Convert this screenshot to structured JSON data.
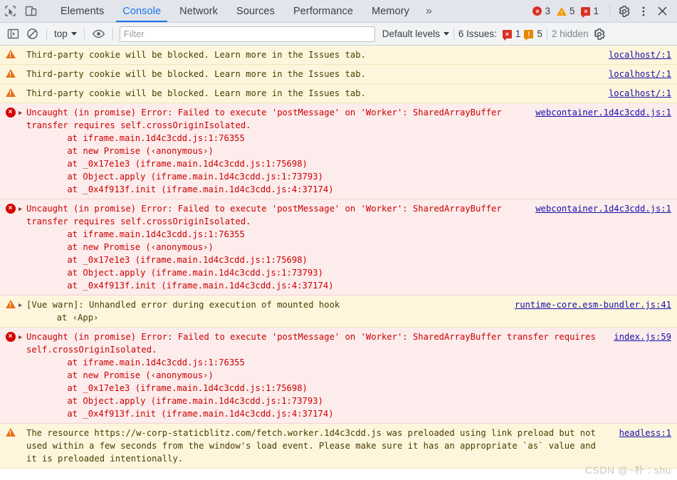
{
  "tabbar": {
    "icons": [
      {
        "name": "inspect-element-icon"
      },
      {
        "name": "device-toolbar-icon"
      }
    ],
    "tabs": [
      {
        "label": "Elements",
        "active": false
      },
      {
        "label": "Console",
        "active": true
      },
      {
        "label": "Network",
        "active": false
      },
      {
        "label": "Sources",
        "active": false
      },
      {
        "label": "Performance",
        "active": false
      },
      {
        "label": "Memory",
        "active": false
      }
    ],
    "more_label": "»",
    "counters": {
      "errors": "3",
      "warnings": "5",
      "issues": "1",
      "error_glyph": "×",
      "warning_glyph": "!",
      "issue_glyph": "×"
    },
    "settings_label": "settings-gear",
    "menu_label": "more-options",
    "close_label": "close-devtools"
  },
  "console_toolbar": {
    "sidebar_toggle": "console-sidebar-toggle",
    "clear_label": "clear-console",
    "context": "top",
    "eye_label": "live-expressions",
    "filter": {
      "placeholder": "Filter",
      "value": ""
    },
    "levels": "Default levels",
    "issues_label": "6 Issues:",
    "issues_error_count": "1",
    "issues_warn_count": "5",
    "issues_error_glyph": "×",
    "issues_warn_glyph": "!",
    "hidden": "2 hidden",
    "settings_label": "console-settings"
  },
  "colors": {
    "accent": "#1a73e8",
    "error": "#d93025",
    "warning": "#f29900",
    "link": "#1a0dab",
    "warn_bg": "#fdf6dd",
    "error_bg": "#fcecec"
  },
  "messages": [
    {
      "type": "warn",
      "expandable": false,
      "text": "Third-party cookie will be blocked. Learn more in the Issues tab.",
      "source": "localhost/:1",
      "stack": []
    },
    {
      "type": "warn",
      "expandable": false,
      "text": "Third-party cookie will be blocked. Learn more in the Issues tab.",
      "source": "localhost/:1",
      "stack": []
    },
    {
      "type": "warn",
      "expandable": false,
      "text": "Third-party cookie will be blocked. Learn more in the Issues tab.",
      "source": "localhost/:1",
      "stack": []
    },
    {
      "type": "err",
      "expandable": true,
      "text": "Uncaught (in promise) Error: Failed to execute 'postMessage' on 'Worker': SharedArrayBuffer transfer requires self.crossOriginIsolated.",
      "source": "webcontainer.1d4c3cdd.js:1",
      "stack": [
        {
          "prefix": "    at ",
          "link": "iframe.main.1d4c3cdd.js:1:76355",
          "suffix": ""
        },
        {
          "prefix": "    at new Promise (‹anonymous›)",
          "link": "",
          "suffix": ""
        },
        {
          "prefix": "    at _0x17e1e3 (",
          "link": "iframe.main.1d4c3cdd.js:1:75698",
          "suffix": ")"
        },
        {
          "prefix": "    at Object.apply (",
          "link": "iframe.main.1d4c3cdd.js:1:73793",
          "suffix": ")"
        },
        {
          "prefix": "    at _0x4f913f.init (",
          "link": "iframe.main.1d4c3cdd.js:4:37174",
          "suffix": ")"
        }
      ]
    },
    {
      "type": "err",
      "expandable": true,
      "text": "Uncaught (in promise) Error: Failed to execute 'postMessage' on 'Worker': SharedArrayBuffer transfer requires self.crossOriginIsolated.",
      "source": "webcontainer.1d4c3cdd.js:1",
      "stack": [
        {
          "prefix": "    at ",
          "link": "iframe.main.1d4c3cdd.js:1:76355",
          "suffix": ""
        },
        {
          "prefix": "    at new Promise (‹anonymous›)",
          "link": "",
          "suffix": ""
        },
        {
          "prefix": "    at _0x17e1e3 (",
          "link": "iframe.main.1d4c3cdd.js:1:75698",
          "suffix": ")"
        },
        {
          "prefix": "    at Object.apply (",
          "link": "iframe.main.1d4c3cdd.js:1:73793",
          "suffix": ")"
        },
        {
          "prefix": "    at _0x4f913f.init (",
          "link": "iframe.main.1d4c3cdd.js:4:37174",
          "suffix": ")"
        }
      ]
    },
    {
      "type": "warn",
      "expandable": true,
      "text": "[Vue warn]: Unhandled error during execution of mounted hook",
      "source": "runtime-core.esm-bundler.js:41",
      "stack": [
        {
          "prefix": "  at ‹App›",
          "link": "",
          "suffix": ""
        }
      ]
    },
    {
      "type": "err",
      "expandable": true,
      "text": "Uncaught (in promise) Error: Failed to execute 'postMessage' on 'Worker': SharedArrayBuffer transfer requires self.crossOriginIsolated.",
      "source": "index.js:59",
      "stack": [
        {
          "prefix": "    at ",
          "link": "iframe.main.1d4c3cdd.js:1:76355",
          "suffix": ""
        },
        {
          "prefix": "    at new Promise (‹anonymous›)",
          "link": "",
          "suffix": ""
        },
        {
          "prefix": "    at _0x17e1e3 (",
          "link": "iframe.main.1d4c3cdd.js:1:75698",
          "suffix": ")"
        },
        {
          "prefix": "    at Object.apply (",
          "link": "iframe.main.1d4c3cdd.js:1:73793",
          "suffix": ")"
        },
        {
          "prefix": "    at _0x4f913f.init (",
          "link": "iframe.main.1d4c3cdd.js:4:37174",
          "suffix": ")"
        }
      ]
    },
    {
      "type": "warn",
      "expandable": false,
      "text_before_link": "The resource ",
      "inline_link": "https://w-corp-staticblitz.com/fetch.worker.1d4c3cdd.js",
      "text_after_link": " was preloaded using link preload but not used within a few seconds from the window's load event. Please make sure it has an appropriate `as` value and it is preloaded intentionally.",
      "source": "headless:1",
      "stack": []
    }
  ],
  "watermark": "CSDN @~朴 : shu"
}
